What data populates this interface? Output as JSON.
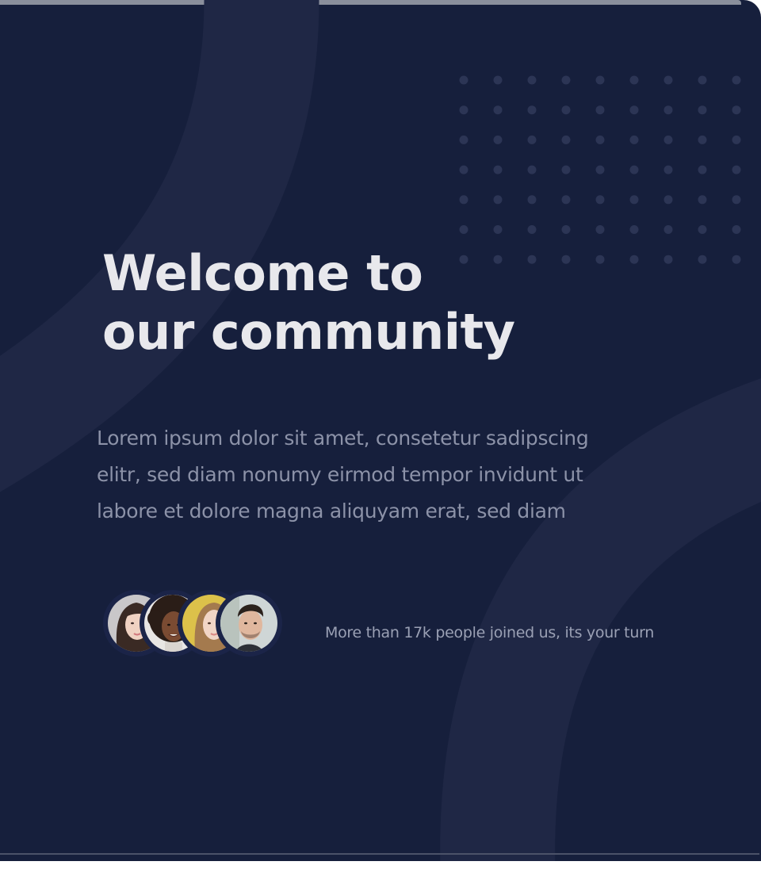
{
  "hero": {
    "headline_line1": "Welcome to",
    "headline_line2": "our community",
    "lead_line1": "Lorem ipsum dolor sit amet, consetetur sadipscing",
    "lead_line2": "elitr, sed diam nonumy eirmod tempor invidunt ut",
    "lead_line3": "labore et dolore magna aliquyam erat, sed diam"
  },
  "community": {
    "joined_text": "More than 17k people joined us, its your turn",
    "avatars": [
      "woman-avatar-1",
      "woman-avatar-2",
      "woman-avatar-3",
      "man-avatar"
    ]
  },
  "colors": {
    "background": "#161f3c",
    "headline": "#e8e8ec",
    "lead_text": "#8c92a8",
    "decor": "#20284a"
  }
}
